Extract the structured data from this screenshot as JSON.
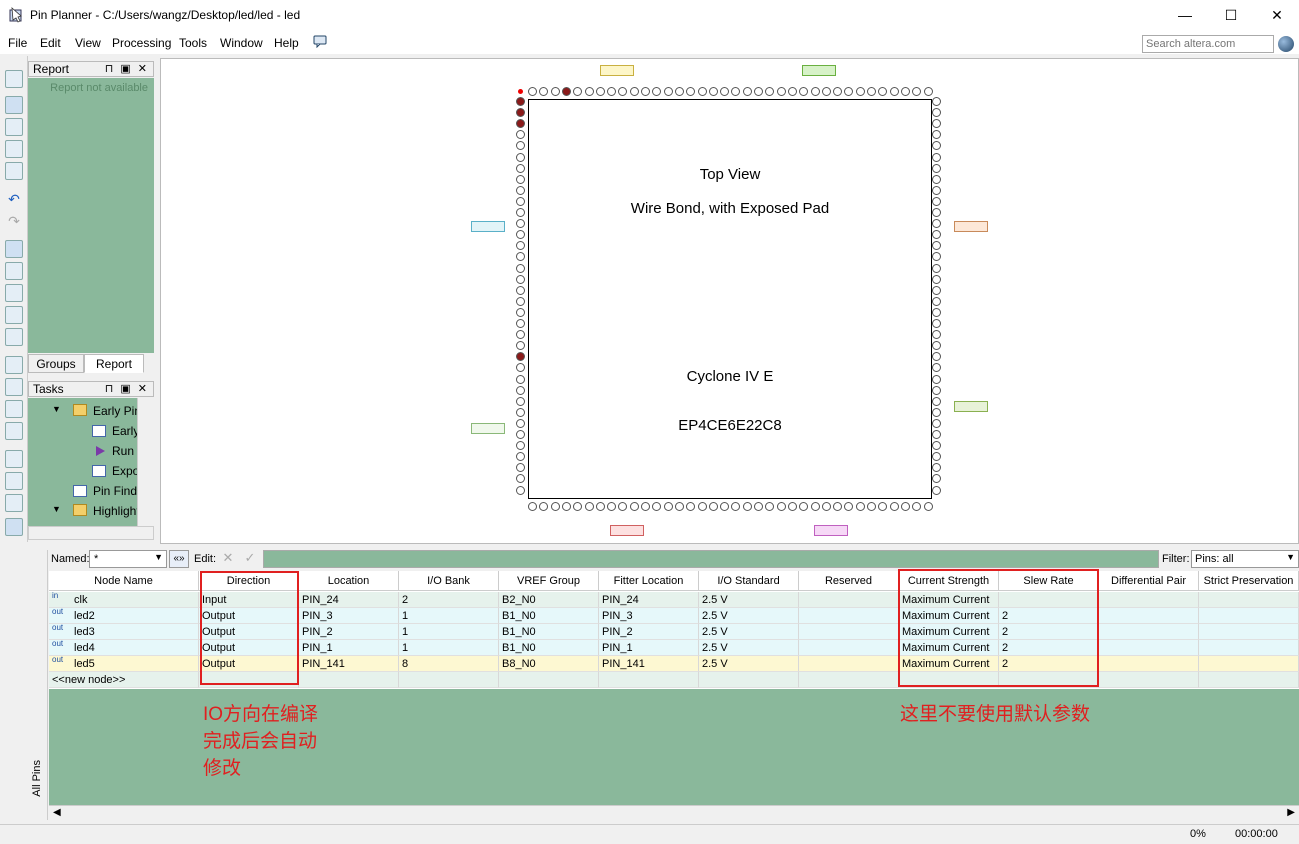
{
  "window": {
    "title": "Pin Planner - C:/Users/wangz/Desktop/led/led - led",
    "minimize": "—",
    "maximize": "☐",
    "close": "✕"
  },
  "menu": [
    "File",
    "Edit",
    "View",
    "Processing",
    "Tools",
    "Window",
    "Help"
  ],
  "search": {
    "placeholder": "Search altera.com"
  },
  "report_panel": {
    "title": "Report",
    "message": "Report not available",
    "controls": "⊓ ▣ ✕"
  },
  "tabs": [
    "Groups",
    "Report"
  ],
  "tasks_panel": {
    "title": "Tasks",
    "controls": "⊓ ▣ ✕",
    "items": [
      "Early Pin",
      "Early",
      "Run",
      "Expo",
      "Pin Finde",
      "Highlight"
    ]
  },
  "chip": {
    "view": "Top View",
    "package": "Wire Bond, with Exposed Pad",
    "family": "Cyclone IV E",
    "device": "EP4CE6E22C8"
  },
  "filter_bar": {
    "named_label": "Named:",
    "named_value": "*",
    "edit_label": "Edit:",
    "filter_label": "Filter:",
    "filter_value": "Pins: all"
  },
  "side_tab": "All Pins",
  "table": {
    "headers": [
      "Node Name",
      "Direction",
      "Location",
      "I/O Bank",
      "VREF Group",
      "Fitter Location",
      "I/O Standard",
      "Reserved",
      "Current Strength",
      "Slew Rate",
      "Differential Pair",
      "Strict Preservation"
    ],
    "rows": [
      {
        "dir_icon": "in",
        "name": "clk",
        "direction": "Input",
        "location": "PIN_24",
        "bank": "2",
        "vref": "B2_N0",
        "fitter": "PIN_24",
        "standard": "2.5 V",
        "reserved": "",
        "current": "Maximum Current",
        "slew": ""
      },
      {
        "dir_icon": "out",
        "name": "led2",
        "direction": "Output",
        "location": "PIN_3",
        "bank": "1",
        "vref": "B1_N0",
        "fitter": "PIN_3",
        "standard": "2.5 V",
        "reserved": "",
        "current": "Maximum Current",
        "slew": "2"
      },
      {
        "dir_icon": "out",
        "name": "led3",
        "direction": "Output",
        "location": "PIN_2",
        "bank": "1",
        "vref": "B1_N0",
        "fitter": "PIN_2",
        "standard": "2.5 V",
        "reserved": "",
        "current": "Maximum Current",
        "slew": "2"
      },
      {
        "dir_icon": "out",
        "name": "led4",
        "direction": "Output",
        "location": "PIN_1",
        "bank": "1",
        "vref": "B1_N0",
        "fitter": "PIN_1",
        "standard": "2.5 V",
        "reserved": "",
        "current": "Maximum Current",
        "slew": "2"
      },
      {
        "dir_icon": "out",
        "name": "led5",
        "direction": "Output",
        "location": "PIN_141",
        "bank": "8",
        "vref": "B8_N0",
        "fitter": "PIN_141",
        "standard": "2.5 V",
        "reserved": "",
        "current": "Maximum Current",
        "slew": "2"
      }
    ],
    "new_node": "<<new node>>"
  },
  "annotations": {
    "left": [
      "IO方向在编译",
      "完成后会自动",
      "修改"
    ],
    "right": "这里不要使用默认参数",
    "color": "#e02020"
  },
  "status": {
    "progress": "0%",
    "time": "00:00:00"
  }
}
